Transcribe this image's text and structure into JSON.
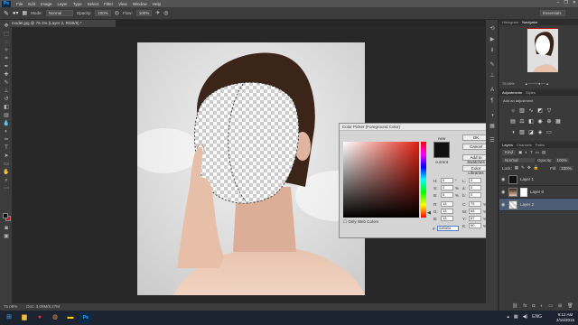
{
  "app": {
    "logo": "Ps",
    "window_controls": [
      "–",
      "❐",
      "✕"
    ]
  },
  "menus": [
    "File",
    "Edit",
    "Image",
    "Layer",
    "Type",
    "Select",
    "Filter",
    "View",
    "Window",
    "Help"
  ],
  "options": {
    "mode_label": "Mode:",
    "mode_value": "Normal",
    "opacity_label": "Opacity:",
    "opacity_value": "100%",
    "flow_label": "Flow:",
    "flow_value": "100%",
    "workspace": "Essentials"
  },
  "document": {
    "tab_title": "model.jpg @ 75.1% (Layer 2, RGB/8) *",
    "zoom": "75.09%",
    "doc_size": "Doc: 3.09M/8.27M"
  },
  "color_picker": {
    "title": "Color Picker (Foreground Color)",
    "buttons": [
      "OK",
      "Cancel",
      "Add to Swatches",
      "Color Libraries"
    ],
    "new_label": "new",
    "current_label": "current",
    "only_web_label": "Only Web Colors",
    "fields_left": [
      {
        "label": "H:",
        "value": "0",
        "unit": "°"
      },
      {
        "label": "S:",
        "value": "0",
        "unit": "%"
      },
      {
        "label": "B:",
        "value": "5",
        "unit": "%"
      },
      {
        "label": "R:",
        "value": "13",
        "unit": ""
      },
      {
        "label": "G:",
        "value": "13",
        "unit": ""
      },
      {
        "label": "B:",
        "value": "13",
        "unit": ""
      }
    ],
    "fields_right": [
      {
        "label": "L:",
        "value": "4",
        "unit": ""
      },
      {
        "label": "a:",
        "value": "0",
        "unit": ""
      },
      {
        "label": "b:",
        "value": "0",
        "unit": ""
      },
      {
        "label": "C:",
        "value": "75",
        "unit": "%"
      },
      {
        "label": "M:",
        "value": "68",
        "unit": "%"
      },
      {
        "label": "Y:",
        "value": "67",
        "unit": "%"
      },
      {
        "label": "K:",
        "value": "90",
        "unit": "%"
      }
    ],
    "hex_label": "#",
    "hex_value": "0d0d0d"
  },
  "navigator": {
    "tabs": [
      "Histogram",
      "Navigator"
    ],
    "zoom": "75.09%"
  },
  "adjustments": {
    "tabs": [
      "Adjustments",
      "Styles"
    ],
    "hint": "Add an adjustment"
  },
  "layers": {
    "tabs": [
      "Layers",
      "Channels",
      "Paths"
    ],
    "kind_label": "Kind",
    "blend_mode": "Normal",
    "opacity_label": "Opacity:",
    "opacity": "100%",
    "lock_label": "Lock:",
    "fill_label": "Fill:",
    "fill": "100%",
    "items": [
      {
        "name": "Layer 1",
        "selected": false
      },
      {
        "name": "Layer 0",
        "selected": false
      },
      {
        "name": "Layer 2",
        "selected": true
      }
    ]
  },
  "taskbar": {
    "time": "9:12 AM",
    "date": "2/16/2016",
    "lang": "ENG"
  }
}
